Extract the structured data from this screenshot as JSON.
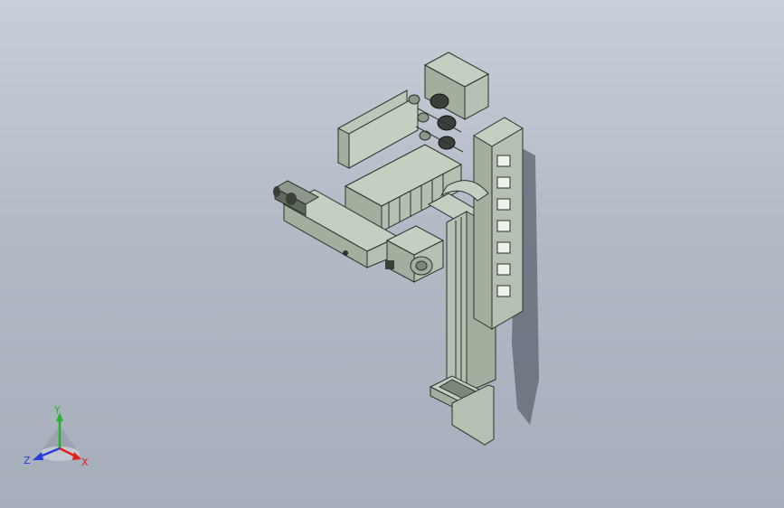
{
  "colors": {
    "background_top": "#c8cfd8",
    "background_bottom": "#a6aebb",
    "part_light": "#bcc6b9",
    "part_mid": "#a3ae9f",
    "part_dark": "#7c877a",
    "edge": "#2c322b",
    "shadow": "#5c6470",
    "axis_x": "#e0201a",
    "axis_y": "#25b52a",
    "axis_z": "#2a3ad8"
  },
  "triad": {
    "x_label": "X",
    "y_label": "Y",
    "z_label": "Z",
    "x_icon": "arrow-x-icon",
    "y_icon": "arrow-y-icon",
    "z_icon": "arrow-z-icon"
  }
}
